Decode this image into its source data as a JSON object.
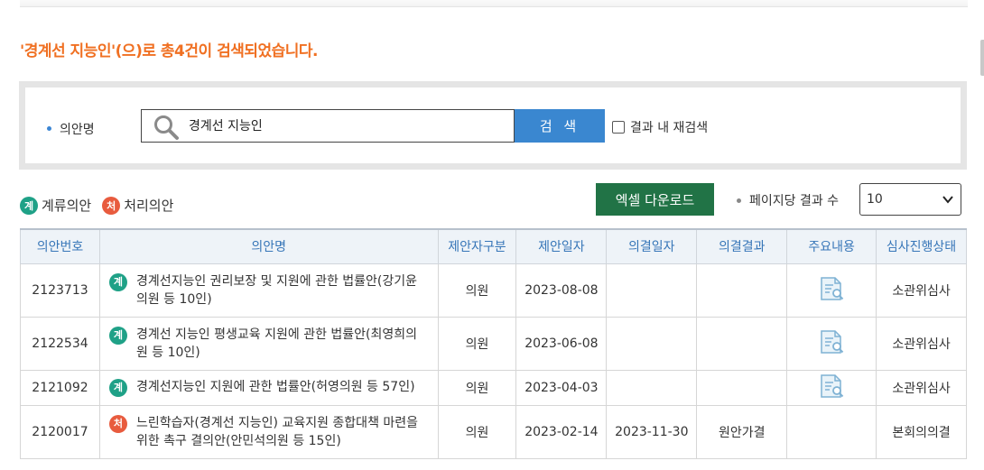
{
  "result_message": "'경계선 지능인'(으)로 총4건이 검색되었습니다.",
  "search": {
    "field_label": "의안명",
    "query": "경계선 지능인",
    "button_label": "검 색",
    "recheck_label": "결과 내 재검색"
  },
  "legend": {
    "pending_badge": "계",
    "pending_label": "계류의안",
    "processed_badge": "처",
    "processed_label": "처리의안"
  },
  "toolbar": {
    "excel_label": "엑셀 다운로드",
    "perpage_label": "페이지당 결과 수",
    "perpage_value": "10"
  },
  "table": {
    "headers": [
      "의안번호",
      "의안명",
      "제안자구분",
      "제안일자",
      "의결일자",
      "의결결과",
      "주요내용",
      "심사진행상태"
    ],
    "rows": [
      {
        "no": "2123713",
        "badge": "계",
        "status_type": "pending",
        "title": "경계선지능인 권리보장 및 지원에 관한 법률안(강기윤의원 등 10인)",
        "proposer": "의원",
        "proposed": "2023-08-08",
        "decided": "",
        "result": "",
        "has_doc": true,
        "stage": "소관위심사"
      },
      {
        "no": "2122534",
        "badge": "계",
        "status_type": "pending",
        "title": "경계선 지능인 평생교육 지원에 관한 법률안(최영희의원 등 10인)",
        "proposer": "의원",
        "proposed": "2023-06-08",
        "decided": "",
        "result": "",
        "has_doc": true,
        "stage": "소관위심사"
      },
      {
        "no": "2121092",
        "badge": "계",
        "status_type": "pending",
        "title": "경계선지능인 지원에 관한 법률안(허영의원 등 57인)",
        "proposer": "의원",
        "proposed": "2023-04-03",
        "decided": "",
        "result": "",
        "has_doc": true,
        "stage": "소관위심사"
      },
      {
        "no": "2120017",
        "badge": "처",
        "status_type": "processed",
        "title": "느린학습자(경계선 지능인) 교육지원 종합대책 마련을 위한 촉구 결의안(안민석의원 등 15인)",
        "proposer": "의원",
        "proposed": "2023-02-14",
        "decided": "2023-11-30",
        "result": "원안가결",
        "has_doc": false,
        "stage": "본회의의결"
      }
    ]
  },
  "colors": {
    "accent_orange": "#f07022",
    "search_blue": "#3a87d0",
    "excel_green": "#217346",
    "pending_badge": "#1fa187",
    "processed_badge": "#e85b3e",
    "header_text": "#3776b8"
  }
}
